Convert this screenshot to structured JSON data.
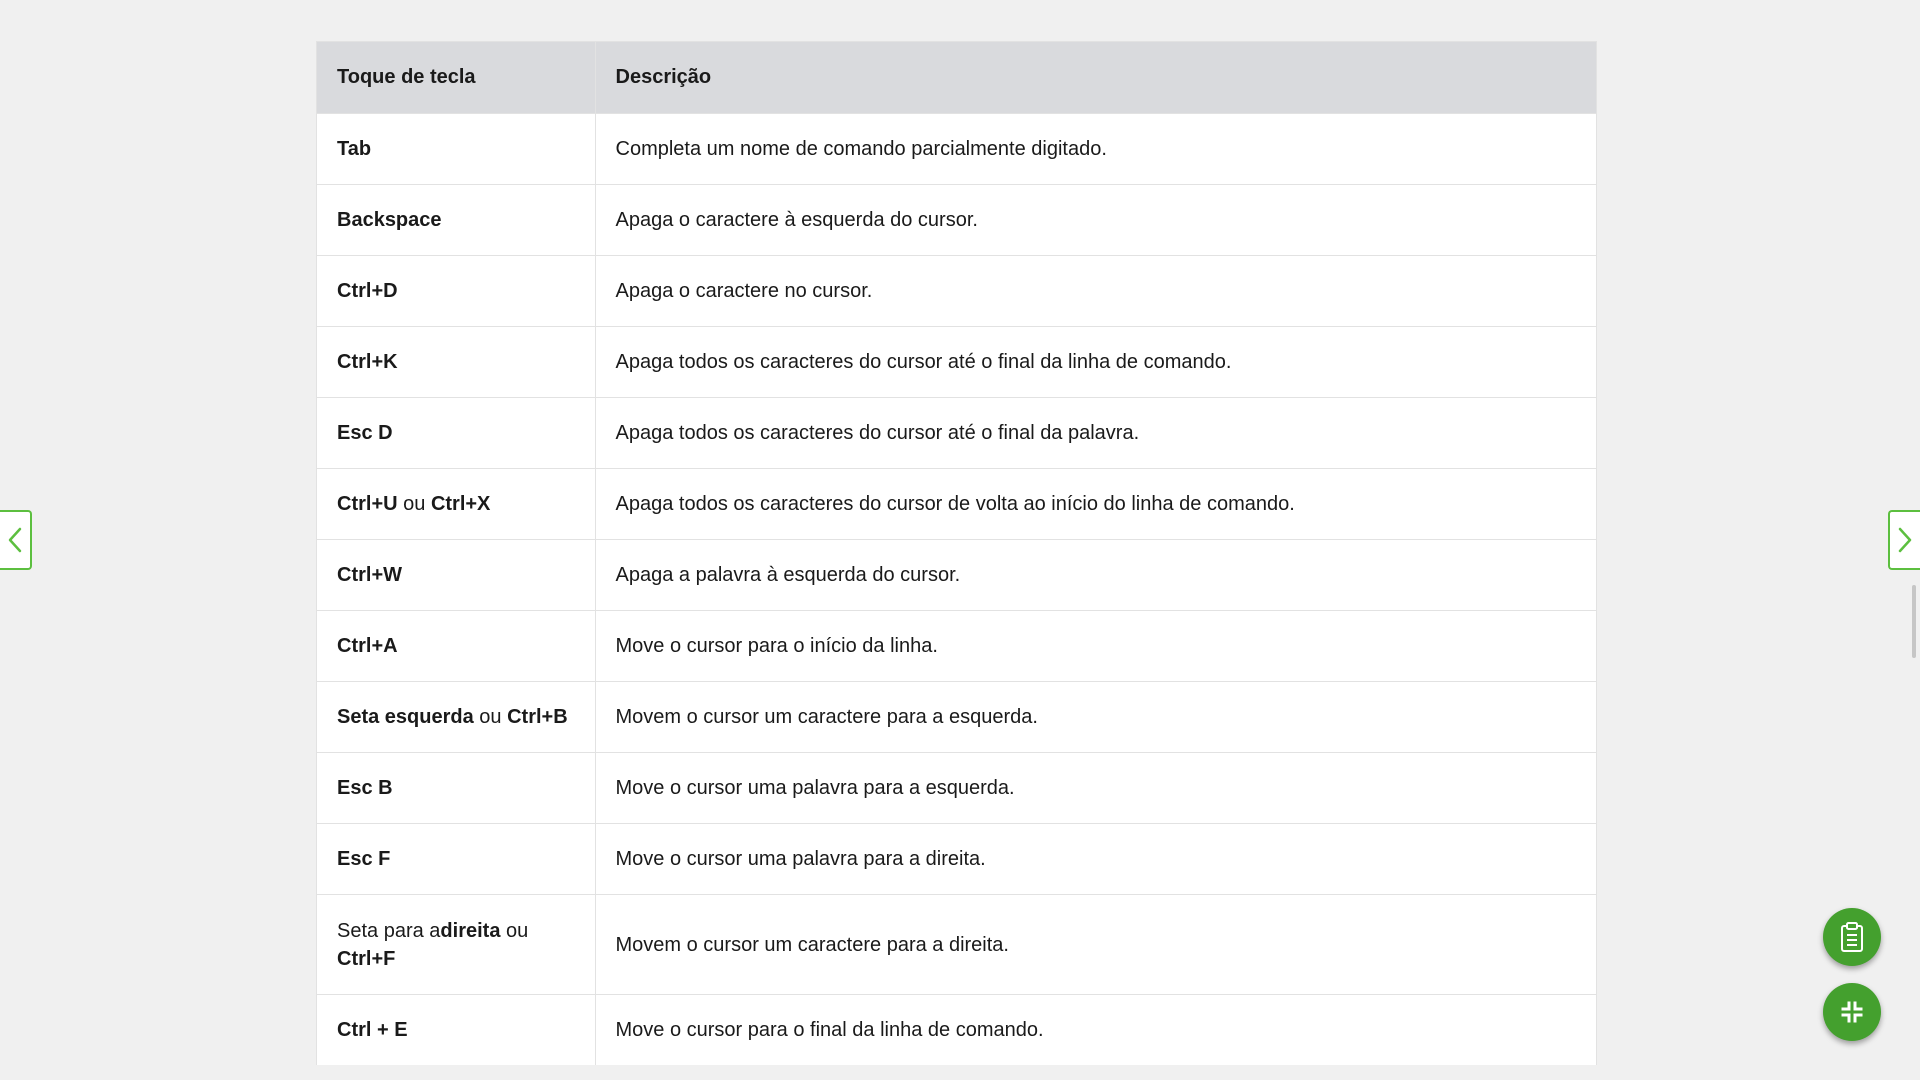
{
  "table": {
    "headers": [
      "Toque de tecla",
      "Descrição"
    ],
    "rows": [
      {
        "key": [
          {
            "t": "Tab",
            "b": true
          }
        ],
        "desc": "Completa um nome de comando parcialmente digitado."
      },
      {
        "key": [
          {
            "t": "Backspace",
            "b": true
          }
        ],
        "desc": "Apaga o caractere à esquerda do cursor."
      },
      {
        "key": [
          {
            "t": "Ctrl+D",
            "b": true
          }
        ],
        "desc": "Apaga o caractere no cursor."
      },
      {
        "key": [
          {
            "t": "Ctrl+K",
            "b": true
          }
        ],
        "desc": "Apaga todos os caracteres do cursor até o final da linha de comando."
      },
      {
        "key": [
          {
            "t": "Esc D",
            "b": true
          }
        ],
        "desc": "Apaga todos os caracteres do cursor até o final da palavra."
      },
      {
        "key": [
          {
            "t": "Ctrl+U",
            "b": true
          },
          {
            "t": " ou ",
            "b": false
          },
          {
            "t": "Ctrl+X",
            "b": true
          }
        ],
        "desc": "Apaga todos os caracteres do cursor de volta ao início do linha de comando."
      },
      {
        "key": [
          {
            "t": "Ctrl+W",
            "b": true
          }
        ],
        "desc": "Apaga a palavra à esquerda do cursor."
      },
      {
        "key": [
          {
            "t": "Ctrl+A",
            "b": true
          }
        ],
        "desc": "Move o cursor para o início da linha."
      },
      {
        "key": [
          {
            "t": "Seta esquerda",
            "b": true
          },
          {
            "t": " ou ",
            "b": false
          },
          {
            "t": "Ctrl+B",
            "b": true
          }
        ],
        "desc": "Movem o cursor um caractere para a esquerda."
      },
      {
        "key": [
          {
            "t": "Esc B",
            "b": true
          }
        ],
        "desc": "Move o cursor uma palavra para a esquerda."
      },
      {
        "key": [
          {
            "t": "Esc F",
            "b": true
          }
        ],
        "desc": "Move o cursor uma palavra para a direita."
      },
      {
        "key": [
          {
            "t": "Seta para a",
            "b": false
          },
          {
            "t": "direita",
            "b": true
          },
          {
            "t": " ou ",
            "b": false
          },
          {
            "t": "Ctrl+F",
            "b": true
          }
        ],
        "desc": "Movem o cursor um caractere para a direita.",
        "tall": true
      },
      {
        "key": [
          {
            "t": "Ctrl + E",
            "b": true
          }
        ],
        "desc": "Move o cursor para o final da linha de comando."
      }
    ]
  },
  "nav": {
    "prev_icon": "chevron-left-icon",
    "next_icon": "chevron-right-icon"
  },
  "fabs": {
    "clipboard_icon": "clipboard-icon",
    "collapse_icon": "collapse-icon"
  },
  "colors": {
    "accent": "#5cbf3f",
    "fab": "#44a02e",
    "header_bg": "#d9dadd",
    "page_bg": "#f0f0f0"
  }
}
